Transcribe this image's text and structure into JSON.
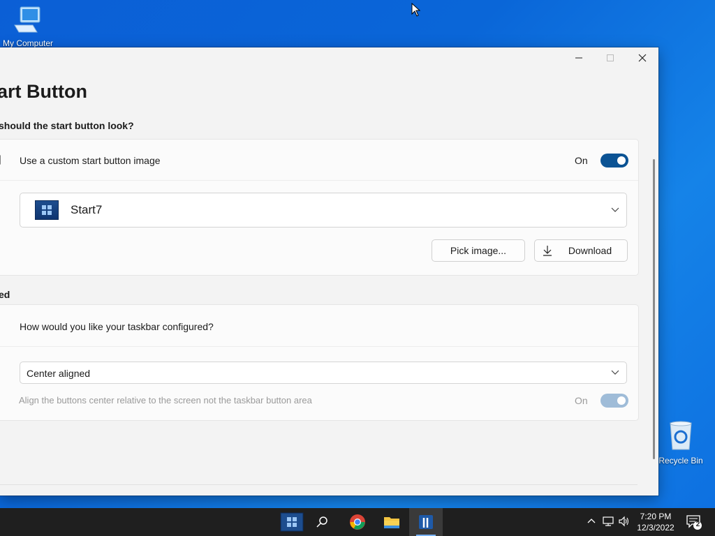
{
  "desktop": {
    "my_computer_label": "My Computer",
    "recycle_bin_label": "Recycle Bin"
  },
  "window": {
    "page_title": "art Button",
    "section1": {
      "header": "should the start button look?",
      "custom_image_label": "Use a custom start button image",
      "custom_image_toggle_text": "On",
      "custom_image_toggle_on": true,
      "selected_style": "Start7",
      "pick_image_label": "Pick image...",
      "download_label": "Download"
    },
    "section2": {
      "header": "ed",
      "taskbar_question": "How would you like your taskbar configured?",
      "alignment_value": "Center aligned",
      "center_screen_label": "Align the buttons center relative to the screen not the taskbar button area",
      "center_screen_toggle_text": "On",
      "center_screen_toggle_on": true,
      "center_screen_disabled": true
    }
  },
  "taskbar": {
    "clock_time": "7:20 PM",
    "clock_date": "12/3/2022",
    "notification_count": "2"
  },
  "colors": {
    "accent": "#0b5394",
    "desktop_blue": "#0a66d8",
    "taskbar": "#1f1f1f"
  }
}
